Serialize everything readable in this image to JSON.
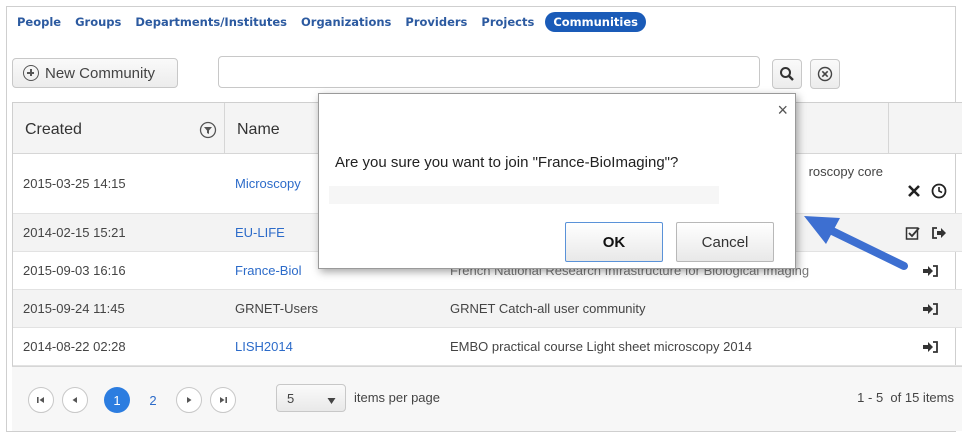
{
  "nav": {
    "items": [
      "People",
      "Groups",
      "Departments/Institutes",
      "Organizations",
      "Providers",
      "Projects"
    ],
    "active": "Communities"
  },
  "toolbar": {
    "new_label": "New Community",
    "search_value": ""
  },
  "grid": {
    "headers": {
      "created": "Created",
      "name": "Name"
    },
    "rows": [
      {
        "created": "2015-03-25 14:15",
        "name": "Microscopy",
        "description": "roscopy core"
      },
      {
        "created": "2014-02-15 15:21",
        "name": "EU-LIFE",
        "description": ""
      },
      {
        "created": "2015-09-03 16:16",
        "name": "France-Biol",
        "description": "French National Research Infrastructure for Biological Imaging"
      },
      {
        "created": "2015-09-24 11:45",
        "name": "GRNET-Users",
        "description": "GRNET Catch-all user community"
      },
      {
        "created": "2014-08-22 02:28",
        "name": "LISH2014",
        "description": "EMBO practical course Light sheet microscopy 2014"
      }
    ]
  },
  "pager": {
    "pages": [
      "1",
      "2"
    ],
    "current": "1",
    "page_size": "5",
    "page_size_label": "items per page",
    "summary": "1 - 5  of 15 items"
  },
  "dialog": {
    "close": "×",
    "message": "Are you sure you want to join \"France-BioImaging\"?",
    "ok": "OK",
    "cancel": "Cancel"
  },
  "colors": {
    "nav_active": "#1a5bb8",
    "link": "#2c6bc9",
    "arrow": "#3d6fd1"
  }
}
